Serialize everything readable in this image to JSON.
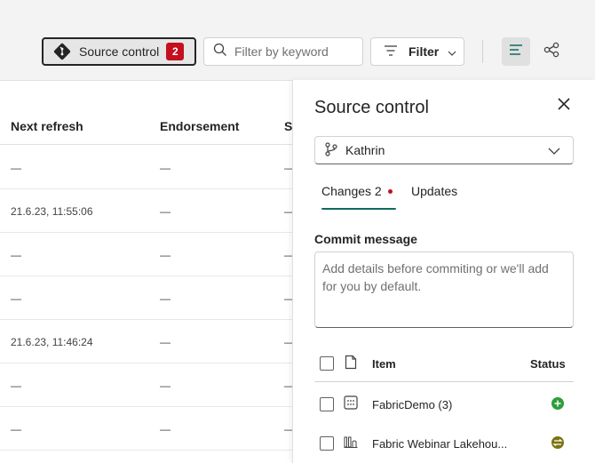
{
  "toolbar": {
    "source_control_label": "Source control",
    "source_control_badge": "2",
    "search_placeholder": "Filter by keyword",
    "filter_label": "Filter"
  },
  "table": {
    "headers": [
      "Next refresh",
      "Endorsement",
      "S"
    ],
    "rows": [
      {
        "next_refresh": "—",
        "endorsement": "—",
        "s": "—"
      },
      {
        "next_refresh": "21.6.23, 11:55:06",
        "endorsement": "—",
        "s": "—"
      },
      {
        "next_refresh": "—",
        "endorsement": "—",
        "s": "—"
      },
      {
        "next_refresh": "—",
        "endorsement": "—",
        "s": "—"
      },
      {
        "next_refresh": "21.6.23, 11:46:24",
        "endorsement": "—",
        "s": "—"
      },
      {
        "next_refresh": "—",
        "endorsement": "—",
        "s": "—"
      },
      {
        "next_refresh": "—",
        "endorsement": "—",
        "s": "—"
      }
    ]
  },
  "panel": {
    "title": "Source control",
    "branch": "Kathrin",
    "tabs": [
      {
        "label": "Changes 2",
        "active": true,
        "has_dot": true
      },
      {
        "label": "Updates",
        "active": false
      }
    ],
    "commit_label": "Commit message",
    "commit_placeholder": "Add details before commiting or we'll add for you by default.",
    "columns": {
      "item": "Item",
      "status": "Status"
    },
    "items": [
      {
        "name": "FabricDemo (3)",
        "type_icon": "grid-item-icon",
        "status_icon": "added-status-icon",
        "status_color": "#2e9e3e"
      },
      {
        "name": "Fabric Webinar Lakehou...",
        "type_icon": "lakehouse-icon",
        "status_icon": "modified-status-icon",
        "status_color": "#7a7411"
      }
    ]
  },
  "colors": {
    "badge": "#c50f1f",
    "accent": "#0f6b5f",
    "added": "#2e9e3e",
    "modified": "#7a7411"
  }
}
